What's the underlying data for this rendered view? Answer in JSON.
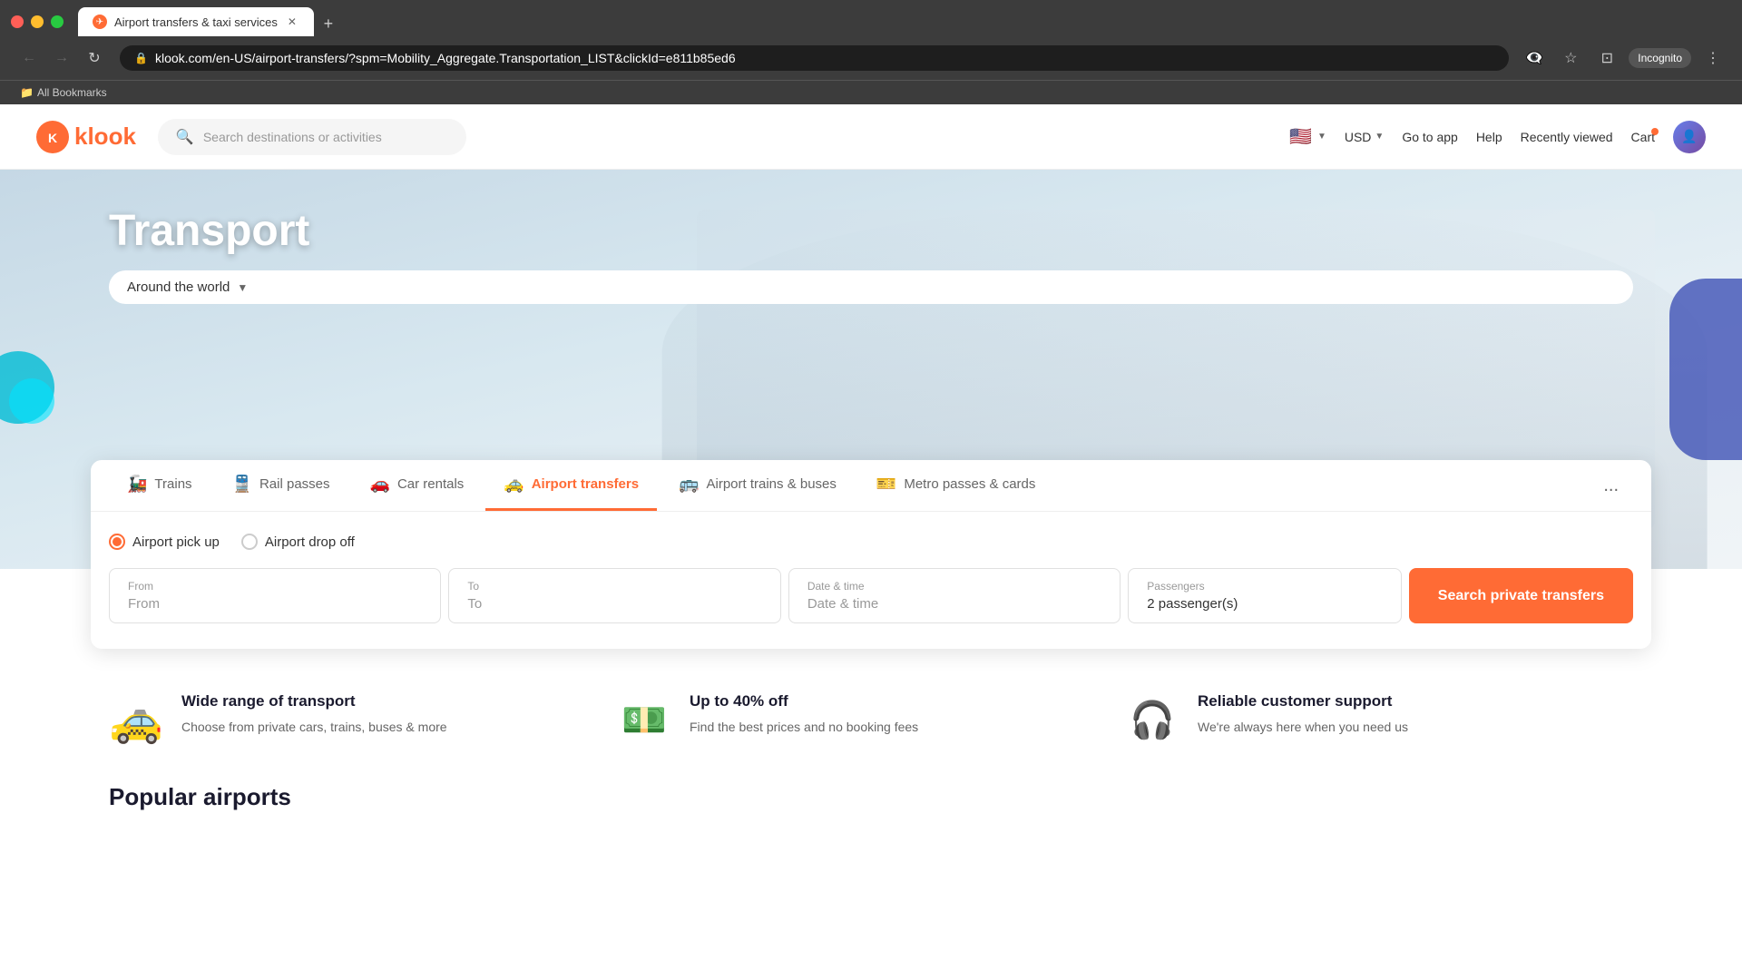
{
  "browser": {
    "tab_title": "Airport transfers & taxi services",
    "tab_favicon": "✈",
    "url": "klook.com/en-US/airport-transfers/?spm=Mobility_Aggregate.Transportation_LIST&clickId=e811b85ed6",
    "incognito_label": "Incognito",
    "bookmarks_label": "All Bookmarks"
  },
  "header": {
    "logo_text": "klook",
    "search_placeholder": "Search destinations or activities",
    "currency": "USD",
    "nav_links": [
      "Go to app",
      "Help",
      "Recently viewed",
      "Cart"
    ]
  },
  "hero": {
    "title": "Transport",
    "world_btn": "Around the world"
  },
  "tabs": {
    "items": [
      {
        "label": "Trains",
        "icon": "🚂"
      },
      {
        "label": "Rail passes",
        "icon": "🚆"
      },
      {
        "label": "Car rentals",
        "icon": "🚗"
      },
      {
        "label": "Airport transfers",
        "icon": "🚕"
      },
      {
        "label": "Airport trains & buses",
        "icon": "🚌"
      },
      {
        "label": "Metro passes & cards",
        "icon": "🎫"
      }
    ],
    "active_index": 3,
    "more_label": "..."
  },
  "search_form": {
    "radio_options": [
      {
        "label": "Airport pick up",
        "checked": true
      },
      {
        "label": "Airport drop off",
        "checked": false
      }
    ],
    "fields": {
      "from_label": "From",
      "from_placeholder": "From",
      "to_label": "To",
      "to_placeholder": "To",
      "datetime_label": "Date & time",
      "datetime_placeholder": "Date & time",
      "passengers_label": "Passengers",
      "passengers_value": "2 passenger(s)"
    },
    "search_btn": "Search private transfers"
  },
  "features": [
    {
      "icon": "🚕",
      "title": "Wide range of transport",
      "description": "Choose from private cars, trains, buses & more"
    },
    {
      "icon": "💵",
      "title": "Up to 40% off",
      "description": "Find the best prices and no booking fees"
    },
    {
      "icon": "🎧",
      "title": "Reliable customer support",
      "description": "We're always here when you need us"
    }
  ],
  "popular_airports": {
    "title": "Popular airports"
  }
}
